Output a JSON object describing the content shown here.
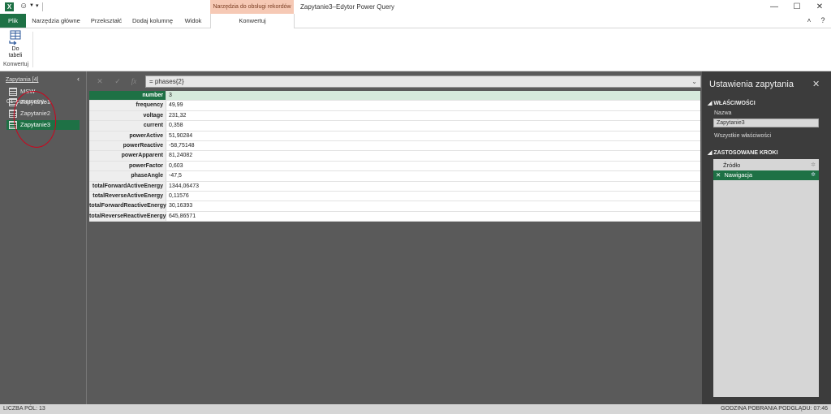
{
  "app": {
    "title": "Zapytanie3–Edytor Power Query",
    "context_tab_group": "Narzędzia do obsługi rekordów",
    "excel_icon": "X"
  },
  "ribbon_tabs": [
    "Plik",
    "Narzędzia główne",
    "Przekształć",
    "Dodaj kolumnę",
    "Widok",
    "Konwertuj"
  ],
  "ribbon": {
    "to_table_line1": "Do",
    "to_table_line2": "tabeli",
    "group_label": "Konwertuj"
  },
  "queries": {
    "header": "Zapytania [4]",
    "items": [
      "MSW-01_parametry-...",
      "Zapytanie1",
      "Zapytanie2",
      "Zapytanie3"
    ],
    "selected": "Zapytanie3"
  },
  "formula_bar": {
    "fx": "fx",
    "formula": "= phases{2}"
  },
  "record": [
    {
      "field": "number",
      "value": "3"
    },
    {
      "field": "frequency",
      "value": "49,99"
    },
    {
      "field": "voltage",
      "value": "231,32"
    },
    {
      "field": "current",
      "value": "0,358"
    },
    {
      "field": "powerActive",
      "value": "51,90284"
    },
    {
      "field": "powerReactive",
      "value": "-58,75148"
    },
    {
      "field": "powerApparent",
      "value": "81,24082"
    },
    {
      "field": "powerFactor",
      "value": "0,603"
    },
    {
      "field": "phaseAngle",
      "value": "-47,5"
    },
    {
      "field": "totalForwardActiveEnergy",
      "value": "1344,06473"
    },
    {
      "field": "totalReverseActiveEnergy",
      "value": "0,11576"
    },
    {
      "field": "totalForwardReactiveEnergy",
      "value": "30,16393"
    },
    {
      "field": "totalReverseReactiveEnergy",
      "value": "645,86571"
    }
  ],
  "settings": {
    "title": "Ustawienia zapytania",
    "properties_header": "WŁAŚCIWOŚCI",
    "name_label": "Nazwa",
    "name_value": "Zapytanie3",
    "all_properties": "Wszystkie właściwości",
    "steps_header": "ZASTOSOWANE KROKI",
    "steps": [
      "Źródło",
      "Nawigacja"
    ],
    "selected_step": "Nawigacja"
  },
  "status": {
    "left": "LICZBA PÓL: 13",
    "right": "GODZINA POBRANIA PODGLĄDU: 07:46"
  },
  "colors": {
    "accent": "#1e7145",
    "context_tab": "#f6c9b5",
    "annotation": "#d0021b"
  }
}
